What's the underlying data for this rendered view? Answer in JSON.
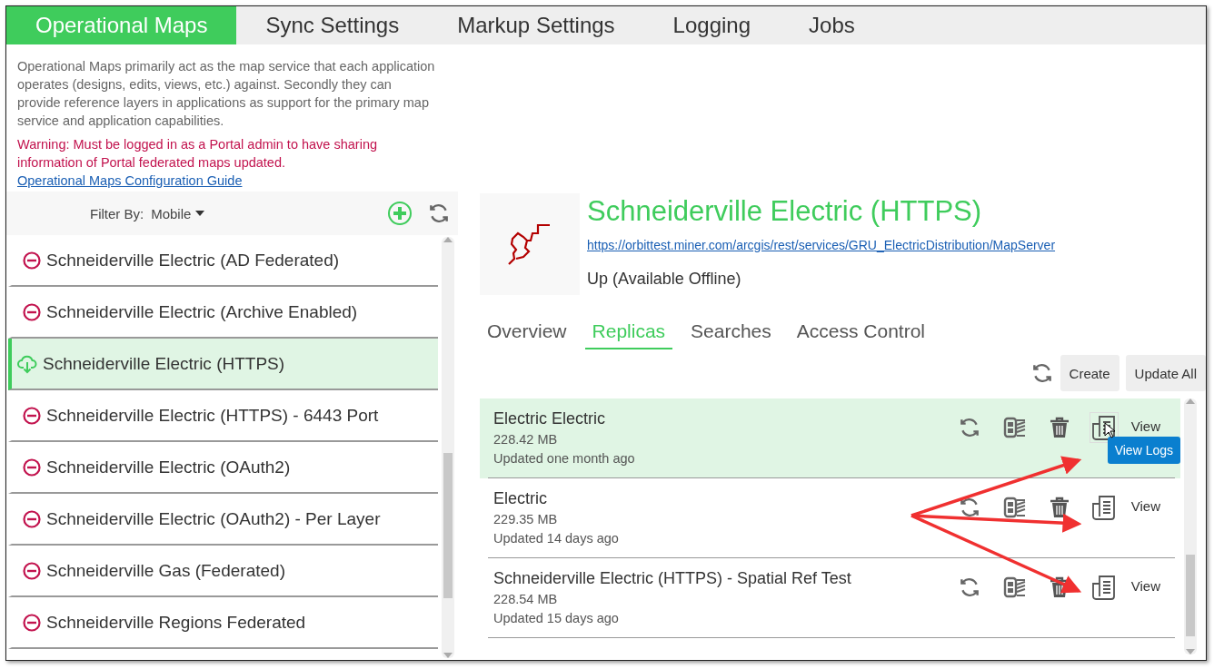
{
  "tabs": [
    {
      "label": "Operational Maps",
      "selected": true
    },
    {
      "label": "Sync Settings",
      "selected": false
    },
    {
      "label": "Markup Settings",
      "selected": false
    },
    {
      "label": "Logging",
      "selected": false
    },
    {
      "label": "Jobs",
      "selected": false
    }
  ],
  "description": "Operational Maps primarily act as the map service that each application operates (designs, edits, views, etc.) against. Secondly they can provide reference layers in applications as support for the primary map service and application capabilities.",
  "warning": "Warning: Must be logged in as a Portal admin to have sharing information of Portal federated maps updated.",
  "guide_link": "Operational Maps Configuration Guide",
  "filter": {
    "label": "Filter By:",
    "value": "Mobile"
  },
  "maps": [
    {
      "name": "Schneiderville Electric (AD Federated)",
      "kind": "unavailable",
      "selected": false
    },
    {
      "name": "Schneiderville Electric (Archive Enabled)",
      "kind": "unavailable",
      "selected": false
    },
    {
      "name": "Schneiderville Electric (HTTPS)",
      "kind": "offline",
      "selected": true
    },
    {
      "name": "Schneiderville Electric (HTTPS) - 6443 Port",
      "kind": "unavailable",
      "selected": false
    },
    {
      "name": "Schneiderville Electric (OAuth2)",
      "kind": "unavailable",
      "selected": false
    },
    {
      "name": "Schneiderville Electric (OAuth2) - Per Layer",
      "kind": "unavailable",
      "selected": false
    },
    {
      "name": "Schneiderville Gas (Federated)",
      "kind": "unavailable",
      "selected": false
    },
    {
      "name": "Schneiderville Regions Federated",
      "kind": "unavailable",
      "selected": false
    }
  ],
  "detail": {
    "title": "Schneiderville Electric (HTTPS)",
    "url": "https://orbittest.miner.com/arcgis/rest/services/GRU_ElectricDistribution/MapServer",
    "status": "Up (Available Offline)",
    "tabs": [
      {
        "label": "Overview",
        "selected": false
      },
      {
        "label": "Replicas",
        "selected": true
      },
      {
        "label": "Searches",
        "selected": false
      },
      {
        "label": "Access Control",
        "selected": false
      }
    ],
    "buttons": [
      "Create",
      "Update All"
    ],
    "replicas": [
      {
        "name": "Electric Electric",
        "size": "228.42 MB",
        "updated": "Updated one month ago",
        "view": "View",
        "selected": true,
        "tooltip": "View Logs"
      },
      {
        "name": "Electric",
        "size": "229.35 MB",
        "updated": "Updated 14 days ago",
        "view": "View",
        "selected": false
      },
      {
        "name": "Schneiderville Electric (HTTPS) - Spatial Ref Test",
        "size": "228.54 MB",
        "updated": "Updated 15 days ago",
        "view": "View",
        "selected": false
      }
    ]
  }
}
